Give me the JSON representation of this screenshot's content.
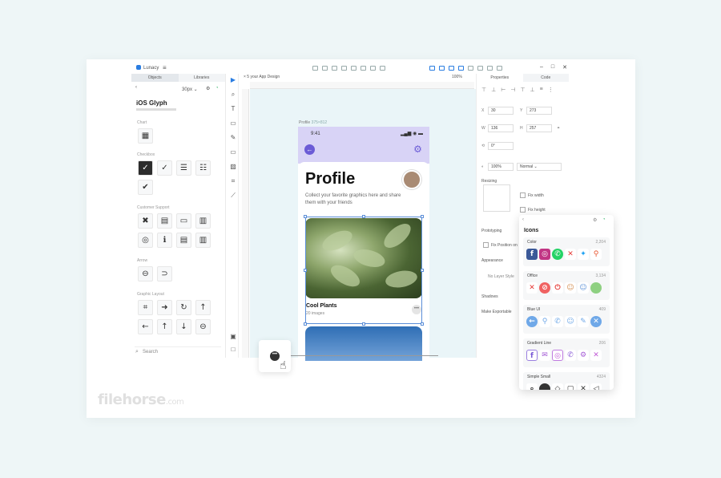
{
  "app": {
    "name": "Lunacy",
    "doc_tab": "× 5 your App Design",
    "zoom": "100%"
  },
  "left_panel": {
    "tabs": [
      "Objects",
      "Libraries"
    ],
    "size": "30px",
    "library_title": "iOS Glyph",
    "categories": [
      "Chart",
      "Checkbox",
      "Customer Support",
      "Arrow",
      "Graphic Layout"
    ],
    "search_placeholder": "Search"
  },
  "artboard": {
    "label": "Profile",
    "dims": "375×812"
  },
  "phone": {
    "time": "9:41",
    "status": "▂▄▆ ◉ ▬",
    "title": "Profile",
    "description": "Collect your favorite graphics here and share them with your friends",
    "collection_name": "Cool Plants",
    "collection_count": "20 images"
  },
  "right_panel": {
    "tabs": [
      "Properties",
      "Code"
    ],
    "x_label": "X",
    "x_value": "30",
    "y_label": "Y",
    "y_value": "273",
    "w_label": "W",
    "w_value": "136",
    "h_label": "H",
    "h_value": "257",
    "rotation_value": "0°",
    "opacity_value": "100%",
    "blend_value": "Normal",
    "resizing_label": "Resizing",
    "fix_width": "Fix width",
    "fix_height": "Fix height",
    "prototyping_label": "Prototyping",
    "fix_position": "Fix Position on",
    "appearance_label": "Appearance",
    "layer_style": "No Layer Style",
    "shadows_label": "Shadows",
    "make_exportable": "Make Exportable"
  },
  "icons_panel": {
    "title": "Icons",
    "sets": [
      {
        "name": "Color",
        "count": "2,204"
      },
      {
        "name": "Office",
        "count": "3,134"
      },
      {
        "name": "Blue UI",
        "count": "409"
      },
      {
        "name": "Gradient Line",
        "count": "206"
      },
      {
        "name": "Simple Small",
        "count": "4324"
      }
    ]
  },
  "watermark": {
    "text": "filehorse",
    "suffix": ".com"
  },
  "colors": {
    "accent": "#2a7de1",
    "phone_header": "#d8d3f6",
    "phone_accent": "#6b5bd6"
  }
}
